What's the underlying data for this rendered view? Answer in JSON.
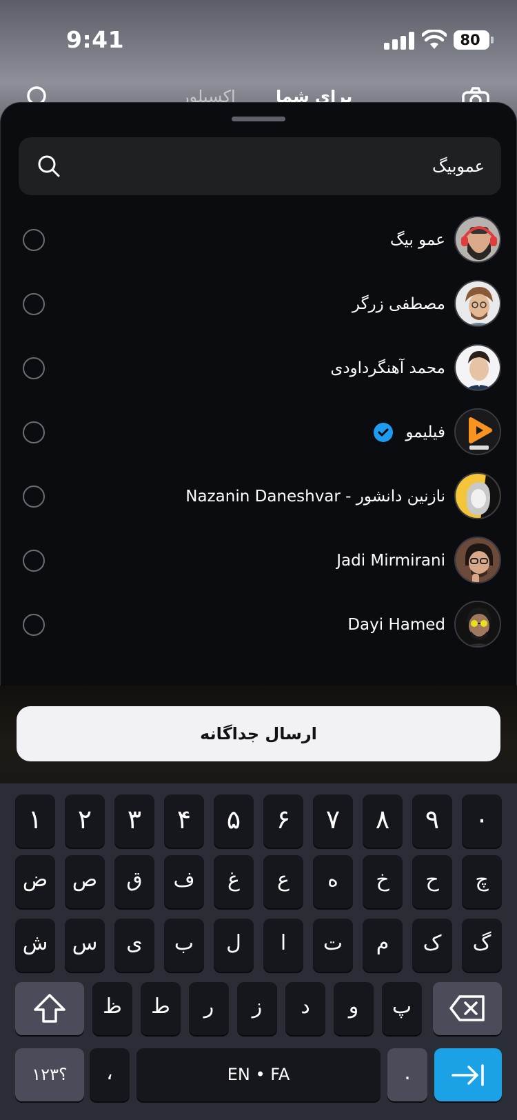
{
  "status_bar": {
    "time": "9:41",
    "battery": "80"
  },
  "behind_header": {
    "tab_active": "برای شما",
    "tab_other": "اکسپلور"
  },
  "search": {
    "value": "عموبیگ"
  },
  "contacts": [
    {
      "name": "عمو بیگ",
      "verified": false
    },
    {
      "name": "مصطفی زرگر",
      "verified": false
    },
    {
      "name": "محمد آهنگرداودی",
      "verified": false
    },
    {
      "name": "فیلیمو",
      "verified": true
    },
    {
      "name": "نازنین دانشور - Nazanin Daneshvar",
      "verified": false
    },
    {
      "name": "Jadi Mirmirani",
      "verified": false
    },
    {
      "name": "Dayi Hamed",
      "verified": false
    }
  ],
  "send_button": {
    "label": "ارسال جداگانه"
  },
  "keyboard": {
    "row1": [
      "۱",
      "۲",
      "۳",
      "۴",
      "۵",
      "۶",
      "۷",
      "۸",
      "۹",
      "۰"
    ],
    "row2": [
      "ض",
      "ص",
      "ق",
      "ف",
      "غ",
      "ع",
      "ه",
      "خ",
      "ح",
      "چ"
    ],
    "row3": [
      "ش",
      "س",
      "ی",
      "ب",
      "ل",
      "ا",
      "ت",
      "م",
      "ک",
      "گ"
    ],
    "row4": [
      "ظ",
      "ط",
      "ر",
      "ز",
      "د",
      "و",
      "پ"
    ],
    "numbers_key": "؟۱۲۳",
    "comma_key": "،",
    "space_key": "EN • FA",
    "period_key": ".",
    "colors": {
      "enter": "#1ba1e6"
    }
  },
  "colors": {
    "verified_badge": "#1d9bf0",
    "sheet_bg": "#0b0c0f",
    "filimo_orange": "#f7931e"
  }
}
